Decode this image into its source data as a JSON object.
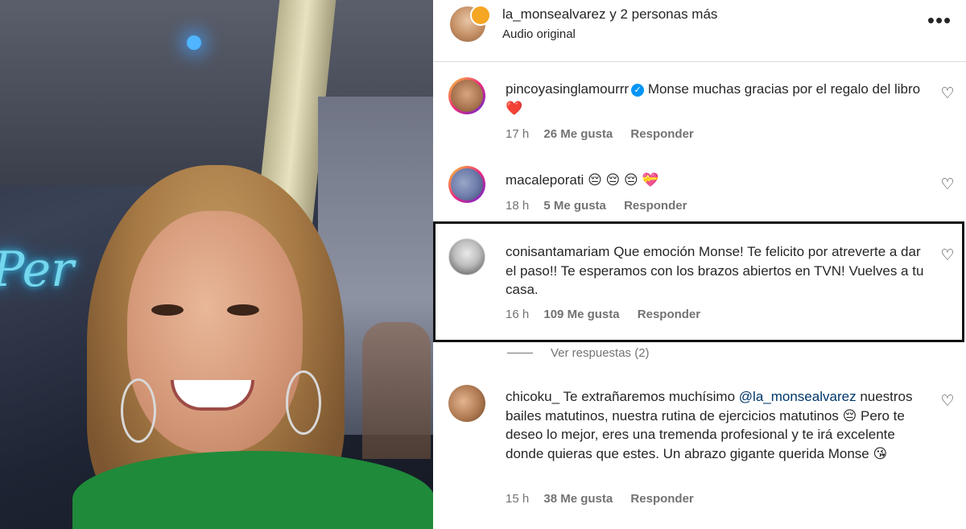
{
  "header": {
    "title": "la_monsealvarez y 2 personas más",
    "subtitle": "Audio original"
  },
  "comments": [
    {
      "username": "pincoyasinglamourrr",
      "verified": true,
      "text": "Monse muchas gracias por el regalo del libro",
      "emoji": "❤️",
      "time": "17 h",
      "likes": "26 Me gusta",
      "reply": "Responder"
    },
    {
      "username": "macaleporati",
      "text": "😔 😔 😔 💝",
      "time": "18 h",
      "likes": "5 Me gusta",
      "reply": "Responder"
    },
    {
      "username": "conisantamariam",
      "text": "Que emoción Monse! Te felicito por atreverte a dar el paso!! Te esperamos con los brazos abiertos en TVN! Vuelves a tu casa.",
      "time": "16 h",
      "likes": "109 Me gusta",
      "reply": "Responder",
      "view_replies": "Ver respuestas (2)"
    },
    {
      "username": "chicoku_",
      "text_before": "Te extrañaremos muchísimo",
      "mention": "@la_monsealvarez",
      "text_after": "nuestros bailes matutinos, nuestra rutina de ejercicios matutinos 😔 Pero te deseo lo mejor, eres una tremenda profesional y te irá excelente donde quieras que estes. Un abrazo gigante querida Monse 😘",
      "time": "15 h",
      "likes": "38 Me gusta",
      "reply": "Responder"
    }
  ],
  "icons": {
    "more": "more-options-icon",
    "like": "heart-outline-icon",
    "verified": "verified-badge-icon"
  },
  "colors": {
    "text": "#262626",
    "secondary": "#737373",
    "verified": "#0095f6",
    "mention": "#00376b"
  }
}
